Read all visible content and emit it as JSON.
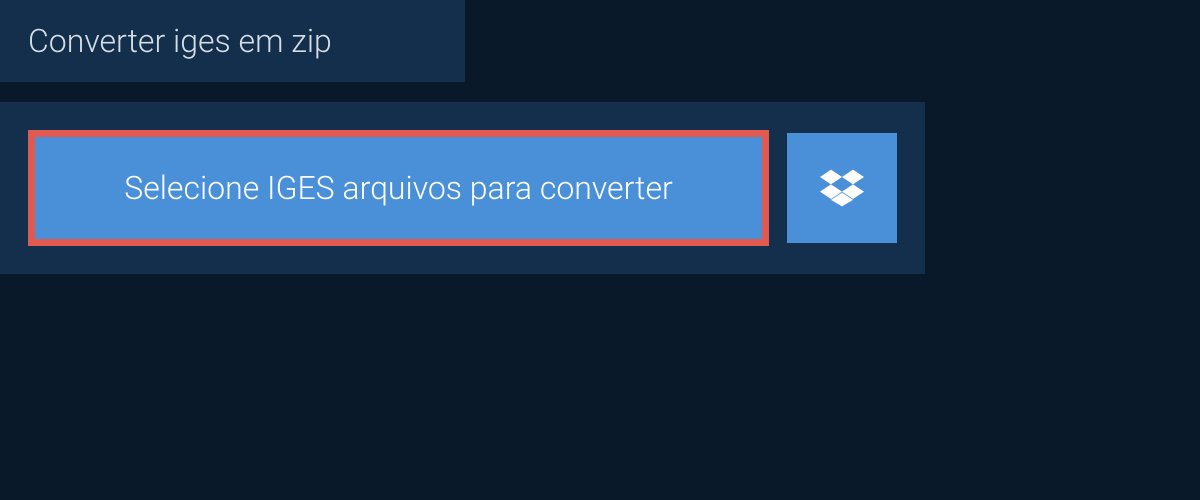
{
  "tab": {
    "title": "Converter iges em zip"
  },
  "upload": {
    "select_label": "Selecione IGES arquivos para converter"
  }
}
